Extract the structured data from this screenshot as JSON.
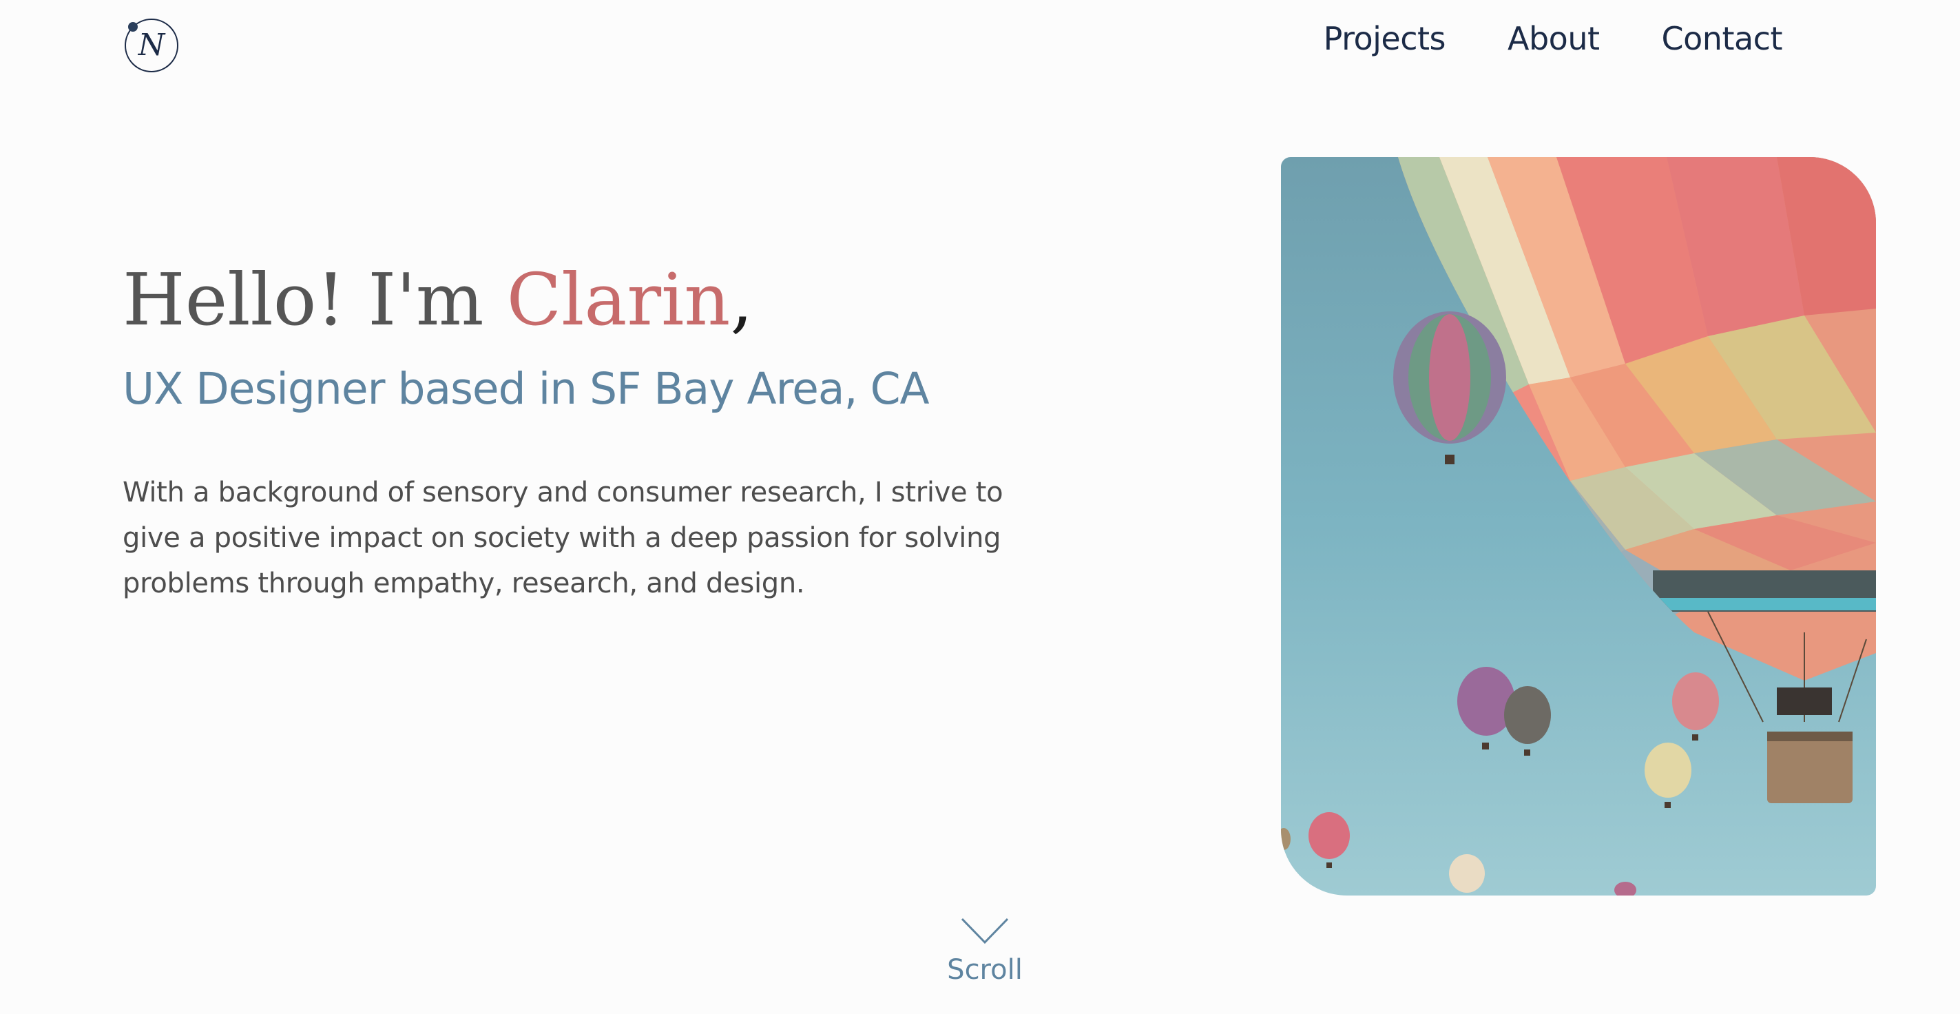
{
  "header": {
    "logo_letter": "N",
    "nav": [
      {
        "label": "Projects"
      },
      {
        "label": "About"
      },
      {
        "label": "Contact"
      }
    ]
  },
  "hero": {
    "greeting_prefix": "Hello! I'm ",
    "name": "Clarin",
    "greeting_suffix": ",",
    "subtitle": "UX Designer based in SF Bay Area, CA",
    "bio": "With a background of sensory and consumer research, I strive to give a positive impact on society with a deep passion for solving problems through empathy, research, and design.",
    "image_icon": "hot-air-balloons-photo"
  },
  "scroll": {
    "icon": "chevron-down-icon",
    "label": "Scroll"
  },
  "colors": {
    "background": "#fcfcfc",
    "nav_text": "#1c2b47",
    "accent_name": "#c76b6b",
    "subtitle": "#5e84a0",
    "body_text": "#4d4d4d",
    "sky": "#7ab3c0"
  }
}
